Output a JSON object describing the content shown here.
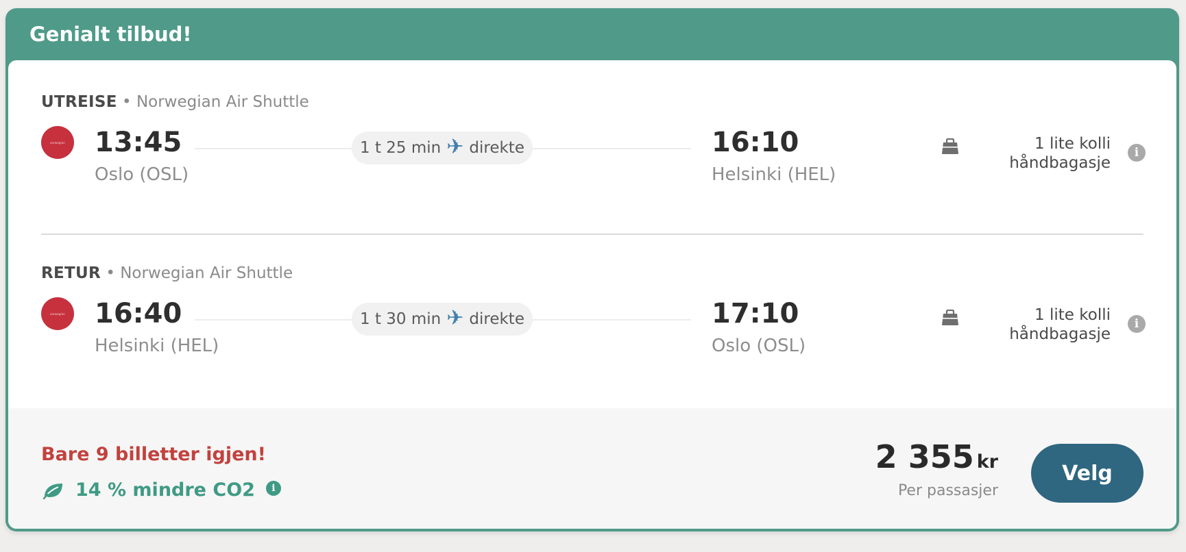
{
  "offer": {
    "title": "Genialt tilbud!"
  },
  "legs": [
    {
      "direction": "UTREISE",
      "airline": "Norwegian Air Shuttle",
      "separator": "•",
      "logo_text": "norwegian",
      "dep_time": "13:45",
      "dep_place": "Oslo (OSL)",
      "duration": "1 t 25 min",
      "stops": "direkte",
      "arr_time": "16:10",
      "arr_place": "Helsinki (HEL)",
      "baggage_line1": "1 lite kolli",
      "baggage_line2": "håndbagasje"
    },
    {
      "direction": "RETUR",
      "airline": "Norwegian Air Shuttle",
      "separator": "•",
      "logo_text": "norwegian",
      "dep_time": "16:40",
      "dep_place": "Helsinki (HEL)",
      "duration": "1 t 30 min",
      "stops": "direkte",
      "arr_time": "17:10",
      "arr_place": "Oslo (OSL)",
      "baggage_line1": "1 lite kolli",
      "baggage_line2": "håndbagasje"
    }
  ],
  "footer": {
    "scarcity": "Bare 9 billetter igjen!",
    "co2": "14 % mindre CO2",
    "price_amount": "2 355",
    "price_currency": "kr",
    "price_per": "Per passasjer",
    "select_label": "Velg"
  },
  "icons": {
    "plane": "airplane-icon",
    "bag": "bag-icon",
    "info": "info-icon",
    "leaf": "leaf-icon"
  },
  "colors": {
    "header": "#4f9a88",
    "price_button": "#2f6680",
    "scarcity": "#c2423e",
    "co2": "#3f9a84",
    "airline_logo": "#c6313d",
    "plane": "#3f7fac"
  }
}
